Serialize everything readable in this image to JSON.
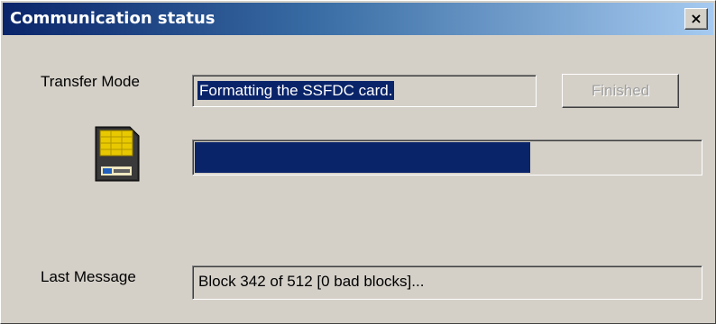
{
  "window": {
    "title": "Communication status",
    "close_glyph": "×"
  },
  "transfer": {
    "label": "Transfer Mode",
    "value": "Formatting the SSFDC card."
  },
  "finished_button": {
    "label": "Finished",
    "enabled": false
  },
  "card_icon": {
    "name": "smartmedia-card-icon",
    "colors": {
      "body": "#2a2a2a",
      "contact": "#e8c800",
      "label": "#f0e8c0"
    }
  },
  "progress": {
    "fraction": 0.665,
    "fill_color": "#0a246a"
  },
  "last_message": {
    "label": "Last Message",
    "value": "Block 342 of 512 [0 bad blocks]..."
  },
  "colors": {
    "face": "#d4d0c8",
    "title_start": "#0a246a",
    "title_end": "#a6caf0",
    "highlight": "#0a246a"
  }
}
